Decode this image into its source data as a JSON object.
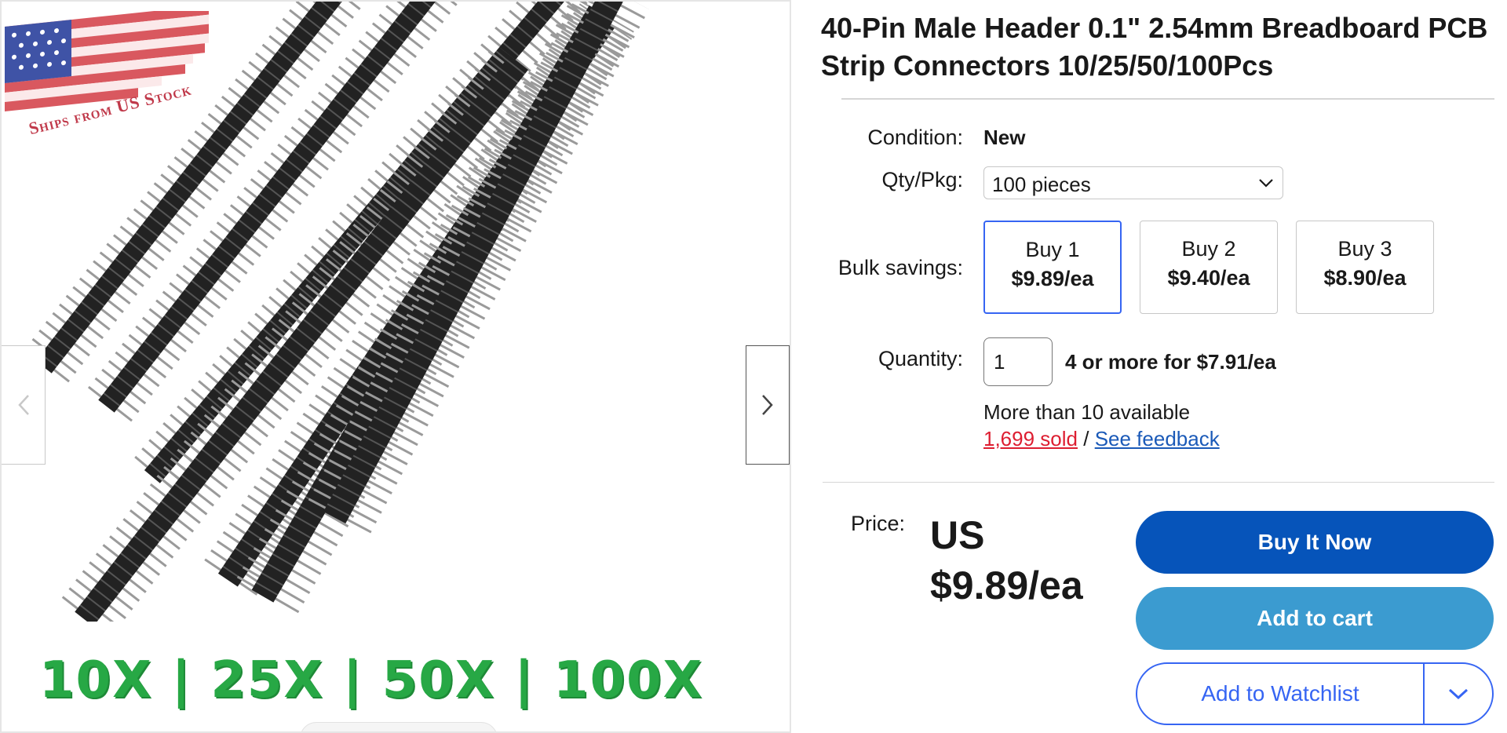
{
  "gallery": {
    "badge_text": "Ships from US Stock",
    "qty_strip": "10X | 25X | 50X | 100X"
  },
  "title": "40-Pin Male Header 0.1\" 2.54mm Breadboard PCB Strip Connectors 10/25/50/100Pcs",
  "condition": {
    "label": "Condition:",
    "value": "New"
  },
  "qty_pkg": {
    "label": "Qty/Pkg:",
    "selected": "100 pieces"
  },
  "bulk": {
    "label": "Bulk savings:",
    "tiles": [
      {
        "qty": "Buy 1",
        "price": "$9.89/ea"
      },
      {
        "qty": "Buy 2",
        "price": "$9.40/ea"
      },
      {
        "qty": "Buy 3",
        "price": "$8.90/ea"
      }
    ]
  },
  "quantity": {
    "label": "Quantity:",
    "value": "1",
    "deal": "4 or more for $7.91/ea",
    "available": "More than 10 available",
    "sold": "1,699 sold",
    "separator": "/",
    "feedback": "See feedback"
  },
  "price": {
    "label": "Price:",
    "value": "US $9.89/ea"
  },
  "buttons": {
    "buy_now": "Buy It Now",
    "add_to_cart": "Add to cart",
    "watchlist": "Add to Watchlist"
  },
  "colors": {
    "buy_now": "#0654ba",
    "add_to_cart": "#3b9bd0",
    "accent": "#3665f3",
    "sold_red": "#dd1e31",
    "strip_green": "#27a845"
  },
  "icons": [
    "chevron-left-icon",
    "chevron-right-icon",
    "chevron-down-icon",
    "us-flag-icon"
  ]
}
